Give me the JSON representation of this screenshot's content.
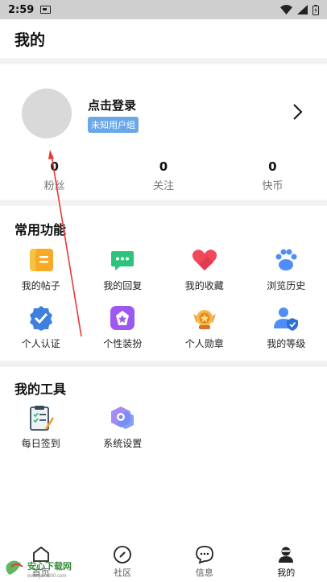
{
  "status_bar": {
    "time": "2:59"
  },
  "header": {
    "title": "我的"
  },
  "profile": {
    "login_text": "点击登录",
    "user_group": "未知用户组",
    "stats": [
      {
        "value": "0",
        "label": "粉丝"
      },
      {
        "value": "0",
        "label": "关注"
      },
      {
        "value": "0",
        "label": "快币"
      }
    ]
  },
  "common_functions": {
    "title": "常用功能",
    "items": [
      {
        "label": "我的帖子",
        "icon": "document-icon"
      },
      {
        "label": "我的回复",
        "icon": "chat-bubble-icon"
      },
      {
        "label": "我的收藏",
        "icon": "heart-icon"
      },
      {
        "label": "浏览历史",
        "icon": "paw-icon"
      },
      {
        "label": "个人认证",
        "icon": "verified-badge-icon"
      },
      {
        "label": "个性装扮",
        "icon": "outfit-icon"
      },
      {
        "label": "个人勋章",
        "icon": "medal-icon"
      },
      {
        "label": "我的等级",
        "icon": "user-shield-icon"
      }
    ]
  },
  "my_tools": {
    "title": "我的工具",
    "items": [
      {
        "label": "每日签到",
        "icon": "checklist-icon"
      },
      {
        "label": "系统设置",
        "icon": "settings-hexagon-icon"
      }
    ]
  },
  "tab_bar": {
    "tabs": [
      {
        "label": "首页",
        "icon": "home-icon"
      },
      {
        "label": "社区",
        "icon": "compass-icon"
      },
      {
        "label": "信息",
        "icon": "message-icon"
      },
      {
        "label": "我的",
        "icon": "profile-icon",
        "active": true
      }
    ]
  },
  "watermark": {
    "brand": "安心下载网",
    "url": "www.java800.com"
  },
  "colors": {
    "badge": "#6aa7e8",
    "annotation_arrow": "#e53935",
    "divider": "#f2f2f2"
  }
}
